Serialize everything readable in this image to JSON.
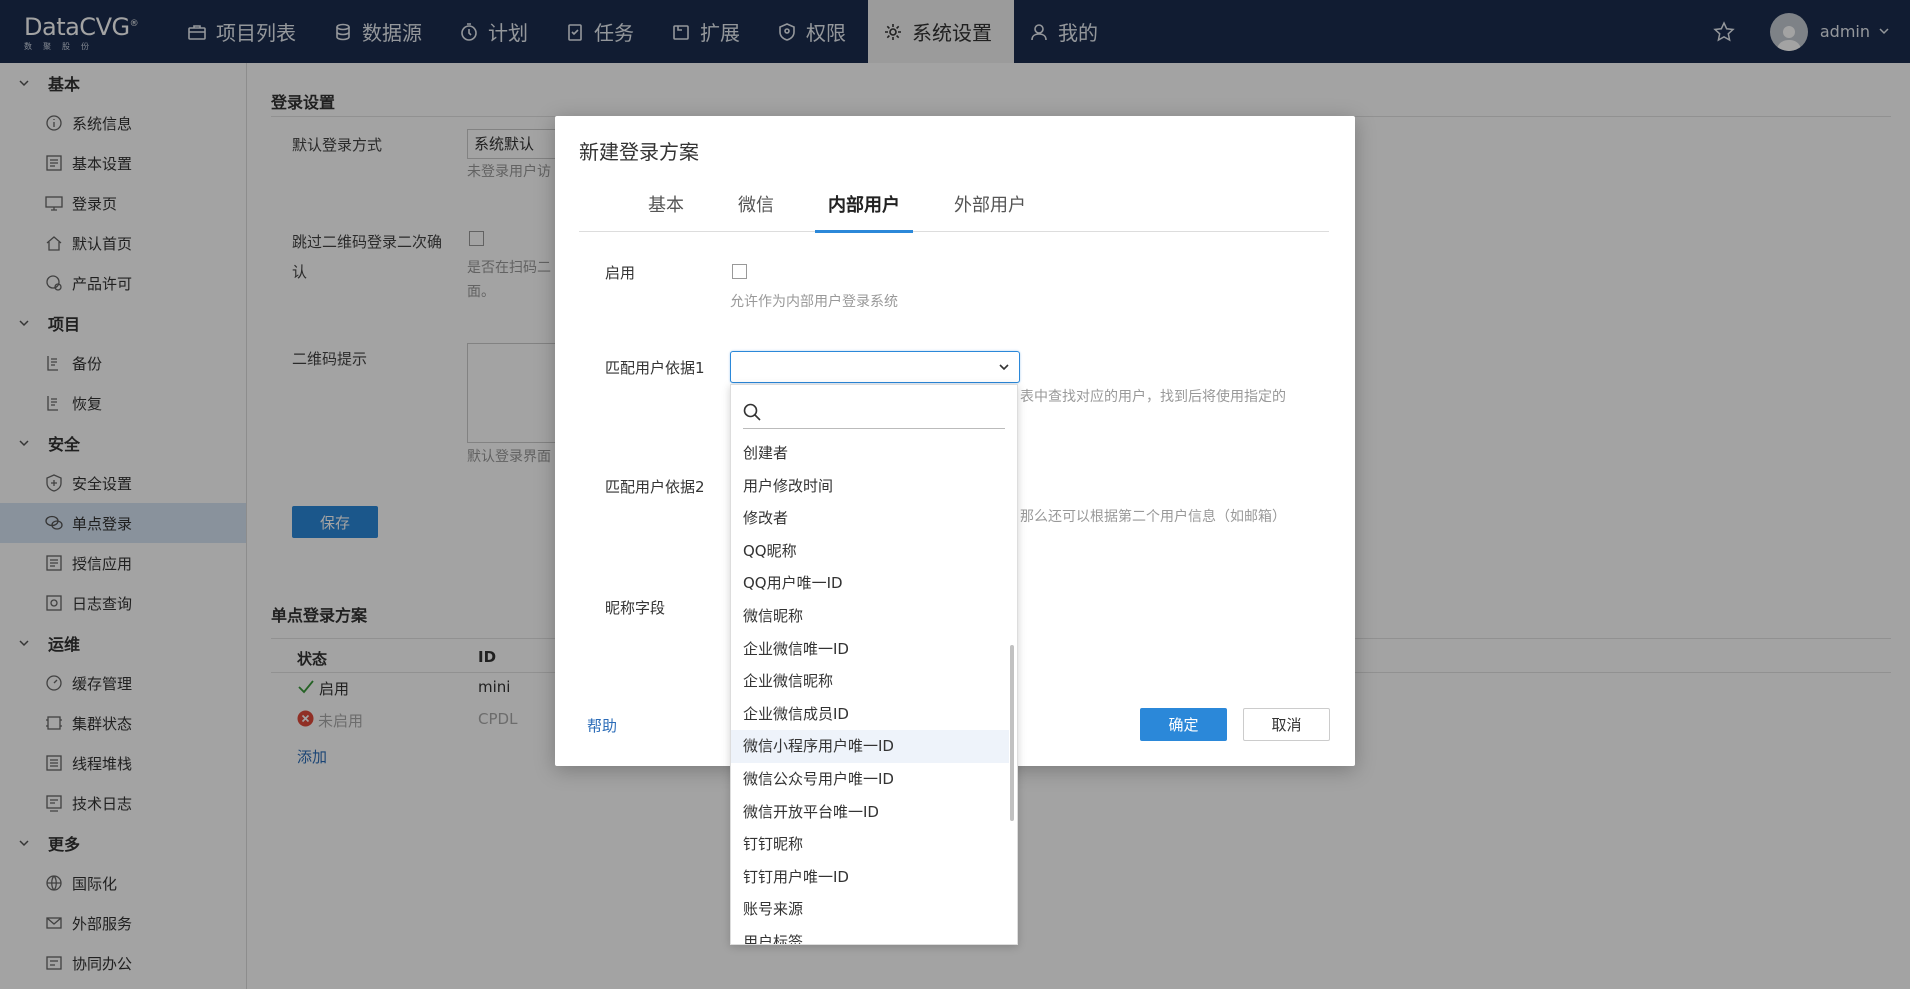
{
  "app": {
    "logo_name": "DataCVG",
    "logo_sub": "数聚股份",
    "nav": [
      {
        "label": "项目列表",
        "icon": "briefcase-icon"
      },
      {
        "label": "数据源",
        "icon": "database-icon"
      },
      {
        "label": "计划",
        "icon": "stopwatch-icon"
      },
      {
        "label": "任务",
        "icon": "clipboard-check-icon"
      },
      {
        "label": "扩展",
        "icon": "extension-icon"
      },
      {
        "label": "权限",
        "icon": "shield-icon"
      },
      {
        "label": "系统设置",
        "icon": "gear-icon"
      },
      {
        "label": "我的",
        "icon": "user-icon"
      }
    ],
    "active_nav": "系统设置",
    "username": "admin"
  },
  "sidebar": {
    "groups": [
      {
        "label": "基本",
        "items": [
          "系统信息",
          "基本设置",
          "登录页",
          "默认首页",
          "产品许可"
        ]
      },
      {
        "label": "项目",
        "items": [
          "备份",
          "恢复"
        ]
      },
      {
        "label": "安全",
        "items": [
          "安全设置",
          "单点登录",
          "授信应用",
          "日志查询"
        ]
      },
      {
        "label": "运维",
        "items": [
          "缓存管理",
          "集群状态",
          "线程堆栈",
          "技术日志"
        ]
      },
      {
        "label": "更多",
        "items": [
          "国际化",
          "外部服务",
          "协同办公"
        ]
      }
    ],
    "active_item": "单点登录"
  },
  "background": {
    "login_settings_title": "登录设置",
    "default_login_label": "默认登录方式",
    "default_login_value": "系统默认",
    "default_login_hint": "未登录用户访",
    "skip_qr_label_line1": "跳过二维码登录二次确",
    "skip_qr_label_line2": "认",
    "skip_qr_hint_line1": "是否在扫码二",
    "skip_qr_hint_line2": "面。",
    "qr_tip_label": "二维码提示",
    "qr_tip_hint": "默认登录界面",
    "save_button": "保存",
    "sso_title": "单点登录方案",
    "table_headers": [
      "状态",
      "ID"
    ],
    "rows": [
      {
        "status": "启用",
        "id": "mini",
        "enabled": true
      },
      {
        "status": "未启用",
        "id": "CPDL",
        "enabled": false
      }
    ],
    "add_link": "添加"
  },
  "modal": {
    "title": "新建登录方案",
    "tabs": [
      "基本",
      "微信",
      "内部用户",
      "外部用户"
    ],
    "active_tab": "内部用户",
    "enable_label": "启用",
    "enable_hint": "允许作为内部用户登录系统",
    "match1_label": "匹配用户依据1",
    "match1_hint": "表中查找对应的用户，找到后将使用指定的",
    "match2_label": "匹配用户依据2",
    "match2_hint": "那么还可以根据第二个用户信息（如邮箱）",
    "nickname_label": "昵称字段",
    "help_link": "帮助",
    "ok_button": "确定",
    "cancel_button": "取消"
  },
  "dropdown": {
    "search_placeholder": "",
    "options": [
      "创建者",
      "用户修改时间",
      "修改者",
      "QQ昵称",
      "QQ用户唯一ID",
      "微信昵称",
      "企业微信唯一ID",
      "企业微信昵称",
      "企业微信成员ID",
      "微信小程序用户唯一ID",
      "微信公众号用户唯一ID",
      "微信开放平台唯一ID",
      "钉钉昵称",
      "钉钉用户唯一ID",
      "账号来源",
      "用户标签"
    ],
    "highlighted": "微信小程序用户唯一ID"
  }
}
